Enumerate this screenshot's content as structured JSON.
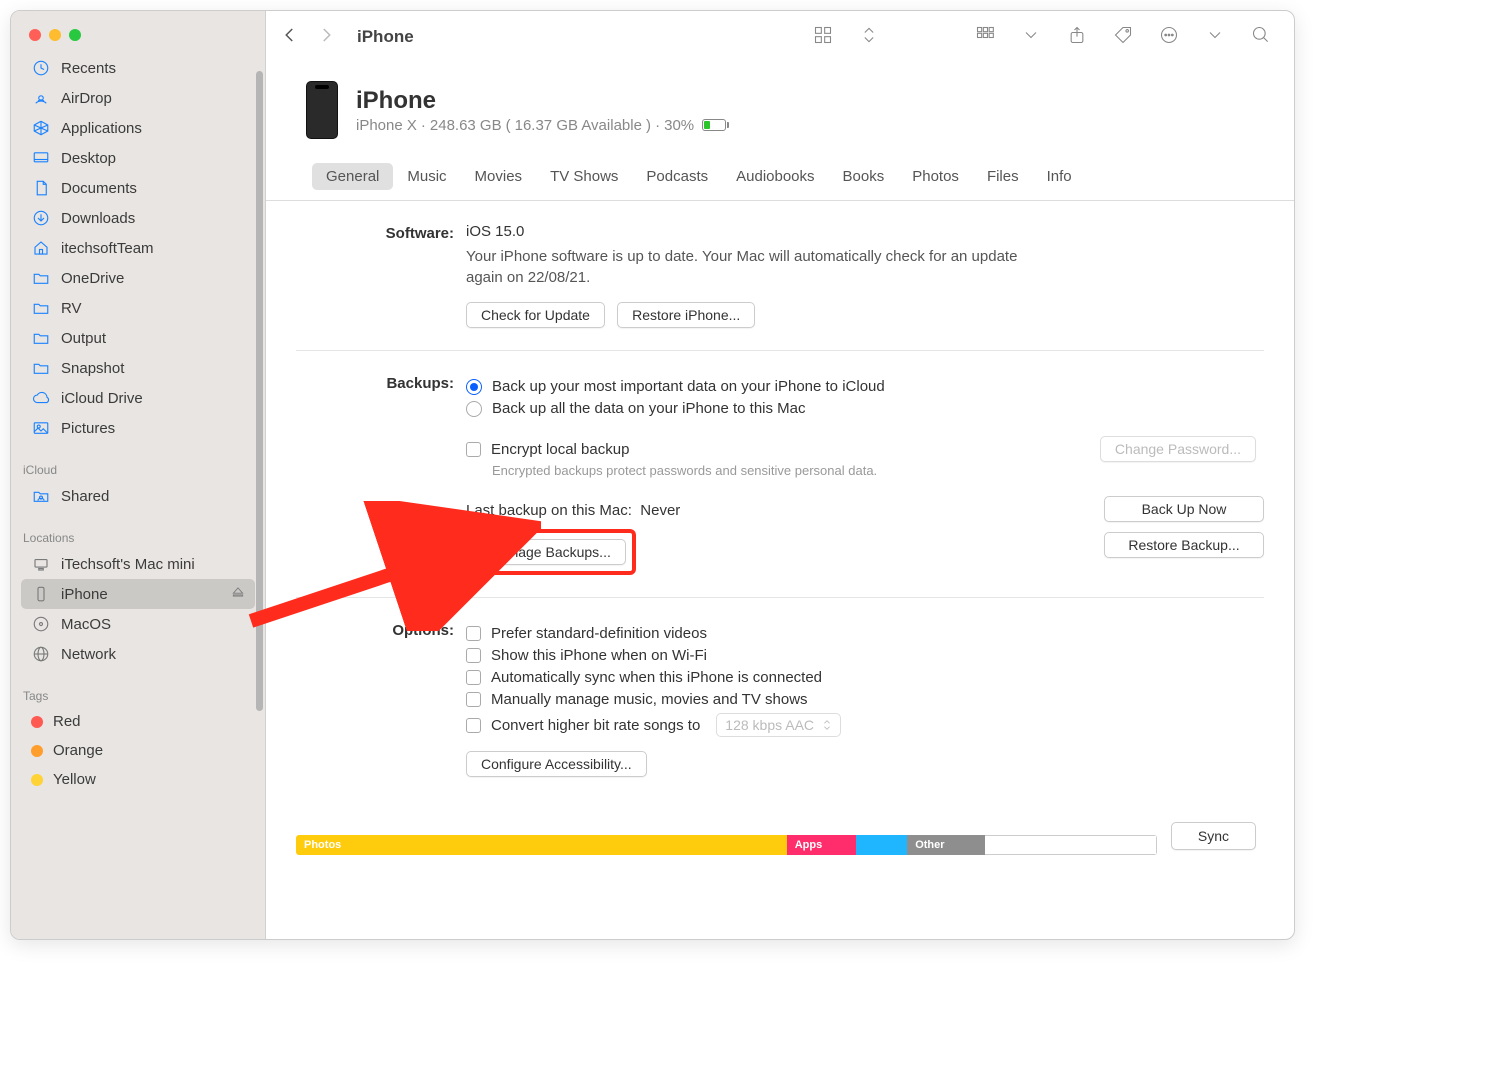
{
  "toolbar": {
    "title": "iPhone"
  },
  "sidebar": {
    "items_top": [
      {
        "label": "Recents",
        "icon": "clock"
      },
      {
        "label": "AirDrop",
        "icon": "airdrop"
      },
      {
        "label": "Applications",
        "icon": "apps"
      },
      {
        "label": "Desktop",
        "icon": "desktop"
      },
      {
        "label": "Documents",
        "icon": "doc"
      },
      {
        "label": "Downloads",
        "icon": "download"
      },
      {
        "label": "itechsoftTeam",
        "icon": "home"
      },
      {
        "label": "OneDrive",
        "icon": "folder"
      },
      {
        "label": "RV",
        "icon": "folder"
      },
      {
        "label": "Output",
        "icon": "folder"
      },
      {
        "label": "Snapshot",
        "icon": "folder"
      },
      {
        "label": "iCloud Drive",
        "icon": "cloud"
      },
      {
        "label": "Pictures",
        "icon": "picture"
      }
    ],
    "icloud_header": "iCloud",
    "icloud_items": [
      {
        "label": "Shared",
        "icon": "shared"
      }
    ],
    "locations_header": "Locations",
    "locations": [
      {
        "label": "iTechsoft's Mac mini",
        "icon": "mac"
      },
      {
        "label": "iPhone",
        "icon": "phone",
        "selected": true,
        "eject": true
      },
      {
        "label": "MacOS",
        "icon": "disk"
      },
      {
        "label": "Network",
        "icon": "globe"
      }
    ],
    "tags_header": "Tags",
    "tags": [
      {
        "label": "Red",
        "color": "#ff5a52"
      },
      {
        "label": "Orange",
        "color": "#ff9e2c"
      },
      {
        "label": "Yellow",
        "color": "#ffd335"
      }
    ]
  },
  "device": {
    "name": "iPhone",
    "model": "iPhone X",
    "storage": "248.63 GB",
    "available": "16.37 GB Available",
    "battery": "30%"
  },
  "tabs": [
    "General",
    "Music",
    "Movies",
    "TV Shows",
    "Podcasts",
    "Audiobooks",
    "Books",
    "Photos",
    "Files",
    "Info"
  ],
  "software": {
    "label": "Software:",
    "version": "iOS 15.0",
    "msg": "Your iPhone software is up to date. Your Mac will automatically check for an update again on 22/08/21.",
    "check_btn": "Check for Update",
    "restore_btn": "Restore iPhone..."
  },
  "backups": {
    "label": "Backups:",
    "opt1": "Back up your most important data on your iPhone to iCloud",
    "opt2": "Back up all the data on your iPhone to this Mac",
    "encrypt": "Encrypt local backup",
    "encrypt_hint": "Encrypted backups protect passwords and sensitive personal data.",
    "change_pwd": "Change Password...",
    "last_backup_label": "Last backup on this Mac:",
    "last_backup_value": "Never",
    "manage": "Manage Backups...",
    "backup_now": "Back Up Now",
    "restore": "Restore Backup..."
  },
  "options": {
    "label": "Options:",
    "items": [
      "Prefer standard-definition videos",
      "Show this iPhone when on Wi-Fi",
      "Automatically sync when this iPhone is connected",
      "Manually manage music, movies and TV shows",
      "Convert higher bit rate songs to"
    ],
    "bitrate": "128 kbps AAC",
    "config": "Configure Accessibility..."
  },
  "storage_bar": [
    {
      "label": "Photos",
      "color": "#ffcb0d",
      "width": "57%"
    },
    {
      "label": "Apps",
      "color": "#ff2d6c",
      "width": "8%"
    },
    {
      "label": "",
      "color": "#1fb5ff",
      "width": "6%"
    },
    {
      "label": "Other",
      "color": "#8e8e8e",
      "width": "9%"
    },
    {
      "label": "",
      "color": "#fff",
      "width": "20%"
    }
  ],
  "sync": "Sync"
}
